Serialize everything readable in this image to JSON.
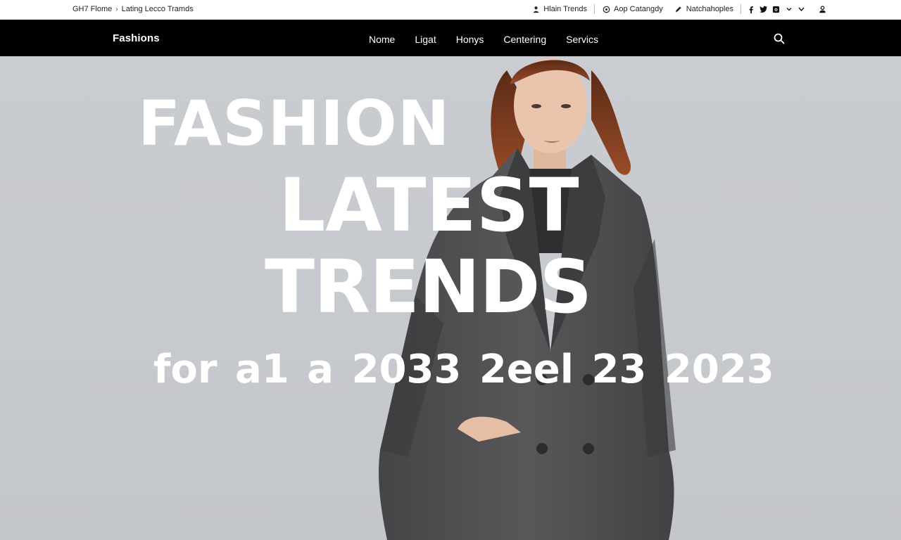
{
  "topbar": {
    "breadcrumb": [
      "GH7 Flome",
      "Lating Lecco Tramds"
    ],
    "breadcrumb_sep": "›",
    "links": [
      {
        "icon": "person-icon",
        "label": "Hlain Trends"
      },
      {
        "icon": "tag-icon",
        "label": "Aop Catangdy"
      },
      {
        "icon": "pen-icon",
        "label": "Natchahoples"
      }
    ],
    "social": [
      "facebook-icon",
      "twitter-icon",
      "instagram-icon",
      "chevron-down-icon",
      "chevron-down-icon",
      "user-icon"
    ]
  },
  "nav": {
    "brand": "Fashions",
    "links": [
      "Nome",
      "Ligat",
      "Honys",
      "Centering",
      "Servics"
    ]
  },
  "hero": {
    "line1": "FASHION",
    "line2": "LATEST",
    "line3": "TRENDS",
    "line4": "for a1 a 2033 2eel  23  2023"
  },
  "colors": {
    "navbar_bg": "#000000",
    "topbar_bg": "#ffffff",
    "hero_bg": "#c8cbd0",
    "coat": "#4f4f51",
    "hair": "#7a3a20"
  }
}
